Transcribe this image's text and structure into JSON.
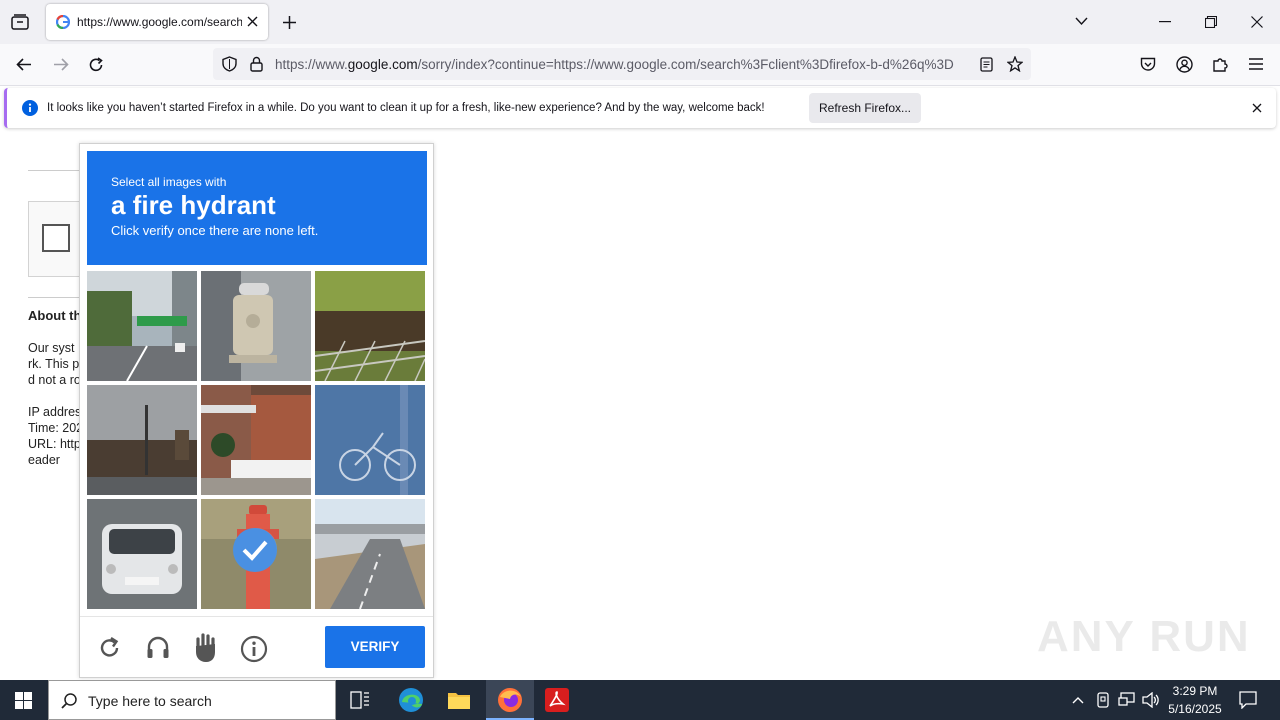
{
  "browser": {
    "tab_title": "https://www.google.com/search",
    "url_prefix": "https://www.",
    "url_domain": "google.com",
    "url_rest": "/sorry/index?continue=https://www.google.com/search%3Fclient%3Dfirefox-b-d%26q%3D"
  },
  "notification": {
    "message": "It looks like you haven’t started Firefox in a while. Do you want to clean it up for a fresh, like-new experience? And by the way, welcome back!",
    "button": "Refresh Firefox..."
  },
  "page": {
    "about_heading": "About th",
    "line1": "Our syst",
    "line2": "rk. This p",
    "line3": "d not a ro",
    "ip": "IP addres",
    "time": "Time: 202",
    "url": "URL: http",
    "reader": "eader"
  },
  "captcha": {
    "instruction_small": "Select all images with",
    "target": "a fire hydrant",
    "instruction_sub": "Click verify once there are none left.",
    "verify_label": "VERIFY",
    "tiles": [
      {
        "name": "highway-sign",
        "selected": false
      },
      {
        "name": "fire-hydrant-gray",
        "selected": false
      },
      {
        "name": "tree-fence",
        "selected": false
      },
      {
        "name": "street-pole",
        "selected": false
      },
      {
        "name": "house-fence",
        "selected": false
      },
      {
        "name": "bicycle",
        "selected": false
      },
      {
        "name": "white-car",
        "selected": false
      },
      {
        "name": "fire-hydrant-red",
        "selected": true
      },
      {
        "name": "road-overpass",
        "selected": false
      }
    ],
    "colors": {
      "header": "#1a73e8",
      "button": "#1a73e8"
    }
  },
  "watermark": "ANY RUN",
  "taskbar": {
    "search_placeholder": "Type here to search",
    "time": "3:29 PM",
    "date": "5/16/2025"
  }
}
